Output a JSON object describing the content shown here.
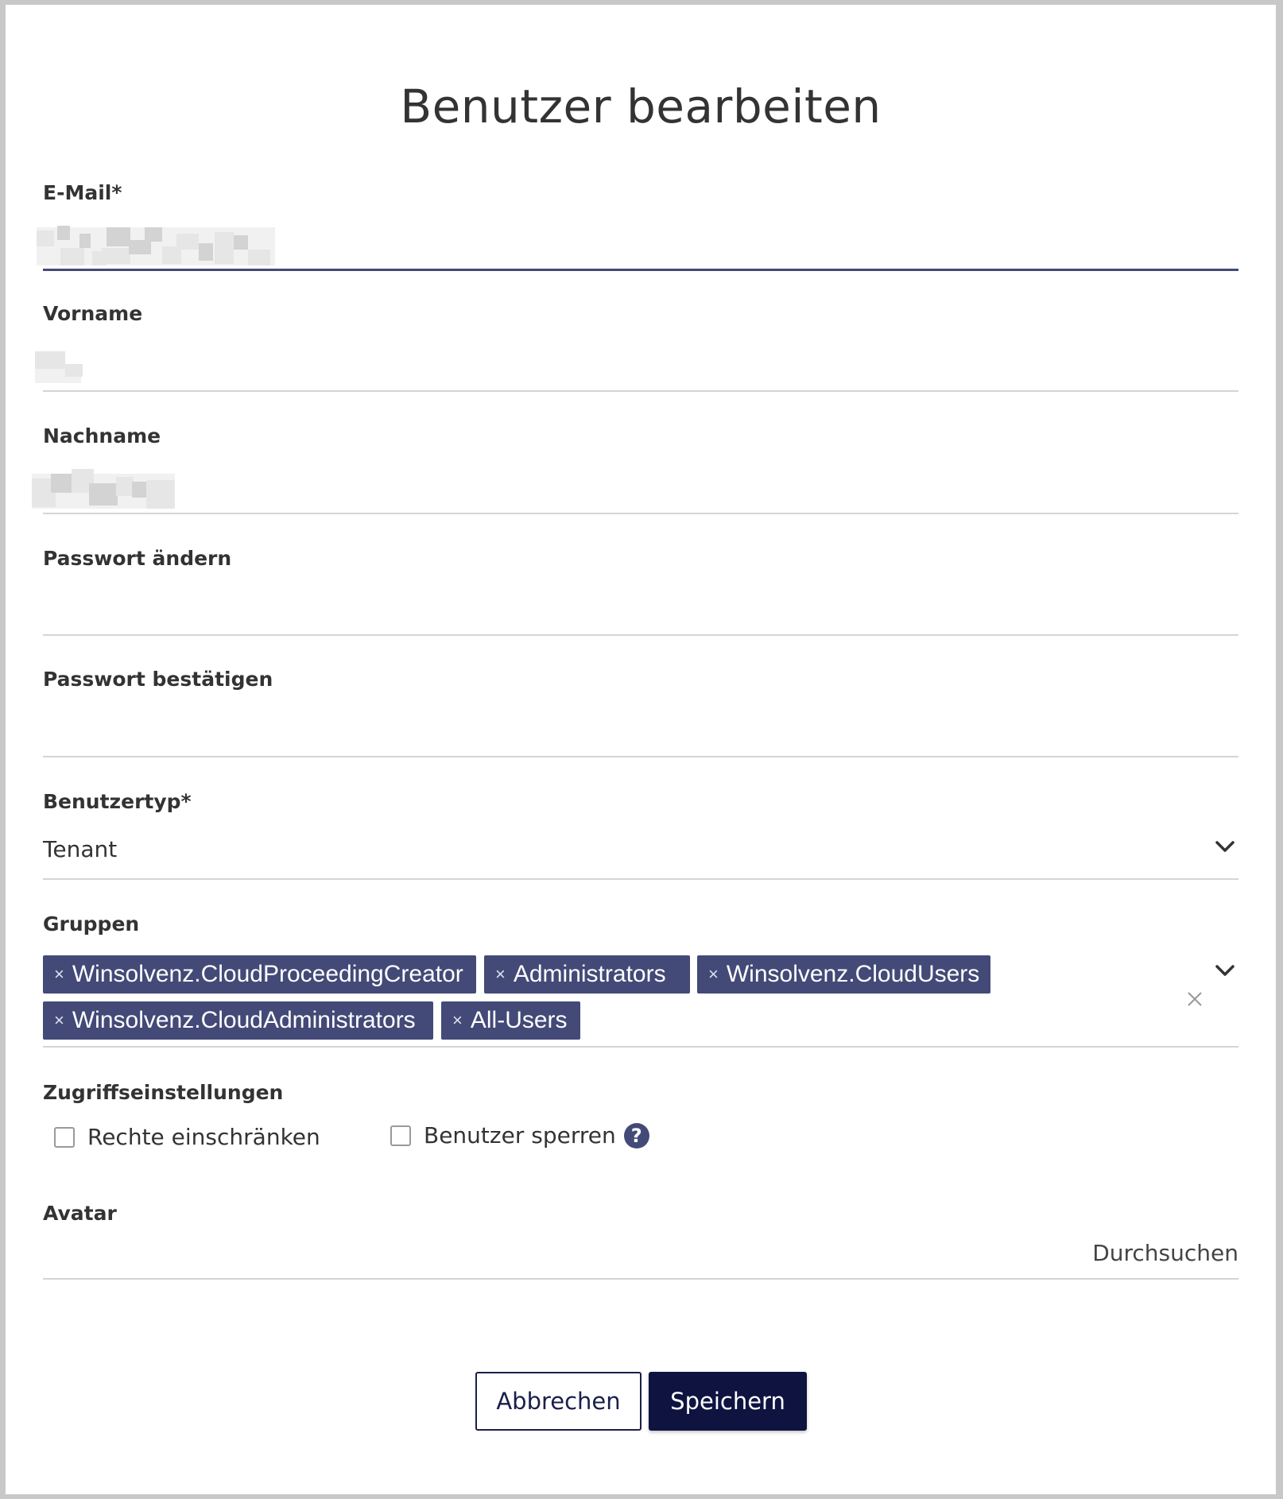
{
  "dialog": {
    "title": "Benutzer bearbeiten"
  },
  "fields": {
    "email": {
      "label": "E-Mail*",
      "value_redacted": true
    },
    "first_name": {
      "label": "Vorname",
      "value_redacted": true
    },
    "last_name": {
      "label": "Nachname",
      "value_redacted": true
    },
    "change_password": {
      "label": "Passwort ändern",
      "value": ""
    },
    "confirm_password": {
      "label": "Passwort bestätigen",
      "value": ""
    },
    "user_type": {
      "label": "Benutzertyp*",
      "value": "Tenant",
      "icon": "chevron-down-icon"
    },
    "groups": {
      "label": "Gruppen",
      "chips": [
        "Winsolvenz.CloudProceedingCreator",
        "Administrators",
        "Winsolvenz.CloudUsers",
        "Winsolvenz.CloudAdministrators",
        "All-Users"
      ],
      "remove_glyph": "×",
      "icons": [
        "chevron-down-icon",
        "clear-icon"
      ]
    },
    "access": {
      "label": "Zugriffseinstellungen",
      "restrict_rights": {
        "label": "Rechte einschränken",
        "checked": false
      },
      "lock_user": {
        "label": "Benutzer sperren",
        "checked": false,
        "help_glyph": "?"
      }
    },
    "avatar": {
      "label": "Avatar",
      "browse_label": "Durchsuchen"
    }
  },
  "buttons": {
    "cancel": "Abbrechen",
    "save": "Speichern"
  },
  "colors": {
    "accent": "#434a77",
    "primary_button": "#0f1340",
    "divider": "#d4d4d4"
  }
}
